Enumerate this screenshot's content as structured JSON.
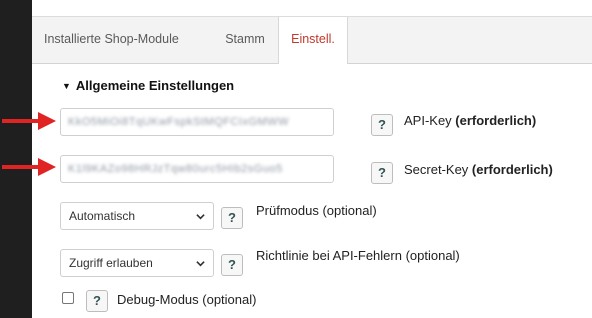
{
  "tabs": {
    "installed": "Installierte Shop-Module",
    "stamm": "Stamm",
    "einstell": "Einstell."
  },
  "section": {
    "title": "Allgemeine Einstellungen"
  },
  "fields": {
    "api_key": {
      "value": "KkO5MiOi8TqUKwFspkStMQFCIxGMWW",
      "label_normal": "API-Key ",
      "label_bold": "(erforderlich)"
    },
    "secret_key": {
      "value": "K1l9KAZo98HRJzTqw80urc5HIb2sGuo5",
      "label_normal": "Secret-Key ",
      "label_bold": "(erforderlich)"
    },
    "test_mode": {
      "selected": "Automatisch",
      "label": "Prüfmodus (optional)"
    },
    "api_error_policy": {
      "selected": "Zugriff erlauben",
      "label": "Richtlinie bei API-Fehlern (optional)"
    },
    "debug_mode": {
      "checked": false,
      "label": "Debug-Modus (optional)"
    }
  },
  "help_glyph": "?",
  "icons": {
    "arrow": "red-arrow-right",
    "chevron": "chevron-down-icon",
    "help": "help-icon"
  },
  "colors": {
    "arrow": "#e02424",
    "active_tab_text": "#c0392b",
    "sidebar": "#1f1f1f"
  }
}
